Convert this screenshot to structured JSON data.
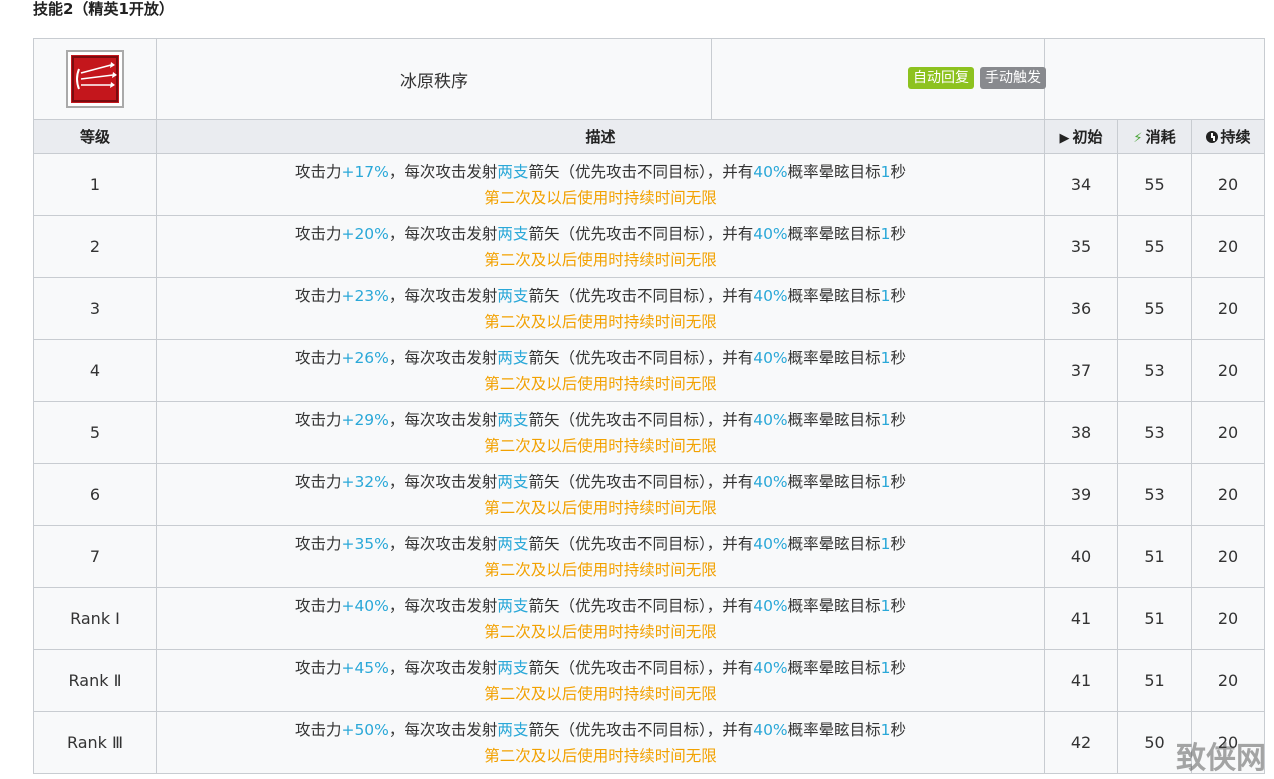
{
  "section_title": "技能2（精英1开放）",
  "skill": {
    "name": "冰原秩序",
    "tags": [
      "自动回复",
      "手动触发"
    ],
    "icon": "skill-arrows-icon"
  },
  "columns": {
    "level": "等级",
    "description": "描述",
    "initial": "初始",
    "cost": "消耗",
    "duration": "持续"
  },
  "desc_parts": {
    "p1": "攻击力",
    "p2": "，每次攻击发射",
    "p3": "两支",
    "p4": "箭矢（优先攻击不同目标），并有",
    "p5": "40%",
    "p6": "概率晕眩目标",
    "p7": "1",
    "p8": "秒",
    "line2": "第二次及以后使用时持续时间无限"
  },
  "rows": [
    {
      "level": "1",
      "atk": "+17%",
      "initial": "34",
      "cost": "55",
      "duration": "20"
    },
    {
      "level": "2",
      "atk": "+20%",
      "initial": "35",
      "cost": "55",
      "duration": "20"
    },
    {
      "level": "3",
      "atk": "+23%",
      "initial": "36",
      "cost": "55",
      "duration": "20"
    },
    {
      "level": "4",
      "atk": "+26%",
      "initial": "37",
      "cost": "53",
      "duration": "20"
    },
    {
      "level": "5",
      "atk": "+29%",
      "initial": "38",
      "cost": "53",
      "duration": "20"
    },
    {
      "level": "6",
      "atk": "+32%",
      "initial": "39",
      "cost": "53",
      "duration": "20"
    },
    {
      "level": "7",
      "atk": "+35%",
      "initial": "40",
      "cost": "51",
      "duration": "20"
    },
    {
      "level": "Rank Ⅰ",
      "atk": "+40%",
      "initial": "41",
      "cost": "51",
      "duration": "20"
    },
    {
      "level": "Rank Ⅱ",
      "atk": "+45%",
      "initial": "41",
      "cost": "51",
      "duration": "20"
    },
    {
      "level": "Rank Ⅲ",
      "atk": "+50%",
      "initial": "42",
      "cost": "50",
      "duration": "20"
    }
  ],
  "watermark": "致侠网"
}
